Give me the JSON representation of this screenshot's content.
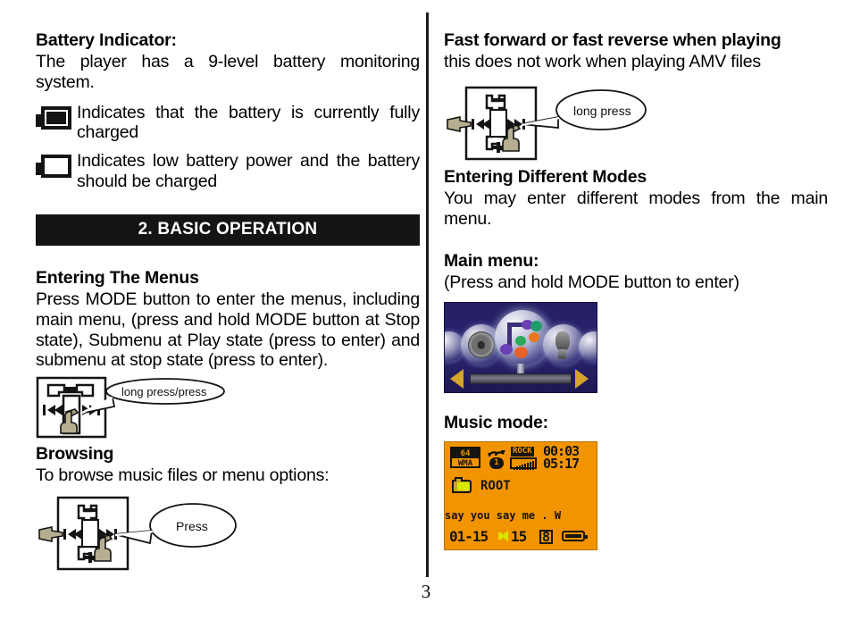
{
  "page": {
    "number": "3"
  },
  "left_column": {
    "battery_section": {
      "heading": "Battery Indicator:",
      "intro": "The player has a 9-level battery monitoring system.",
      "items": [
        {
          "icon": "battery-full-icon",
          "text": "Indicates that the battery is currently fully charged"
        },
        {
          "icon": "battery-empty-icon",
          "text": "Indicates low battery power and the battery should be charged"
        }
      ]
    },
    "section_banner": "2. BASIC OPERATION",
    "menus_section": {
      "heading": "Entering The Menus",
      "body": "Press MODE button to enter the menus, including main menu, (press and hold MODE button at Stop state), Submenu at Play state (press to enter) and submenu at stop state (press to enter).",
      "diagram": {
        "name": "mode-button-diagram",
        "callout": "long press/press"
      }
    },
    "browsing_section": {
      "heading": "Browsing",
      "body": "To browse music files or menu options:",
      "diagram": {
        "name": "browse-button-diagram",
        "callout": "Press"
      }
    }
  },
  "right_column": {
    "ff_rew_section": {
      "heading": "Fast forward or fast reverse when playing",
      "body": "this does not work when playing AMV files",
      "diagram": {
        "name": "fast-forward-button-diagram",
        "callout": "long press"
      }
    },
    "modes_section": {
      "heading": "Entering Different Modes",
      "body": "You may enter different modes from the main menu."
    },
    "main_menu_section": {
      "heading": "Main menu:",
      "body": "(Press and hold MODE button to enter)",
      "screen": {
        "name": "main-menu-lcd",
        "background_color": "#241f63",
        "arrow_color": "#d6a42c",
        "icons": [
          "gear-icon",
          "music-note-icon",
          "microphone-icon",
          "recorder-icon"
        ]
      }
    },
    "music_mode_section": {
      "heading": "Music mode:",
      "screen": {
        "name": "music-mode-lcd",
        "background_color": "#f29400",
        "bitrate": "64",
        "format": "WMA",
        "repeat_count": "1",
        "eq_label": "ROCK",
        "elapsed_time": "00:03",
        "total_time": "05:17",
        "folder": "ROOT",
        "track_title": "say you say me . W",
        "track_index": "01-15",
        "volume": "15",
        "eq_icon": "8",
        "battery_icon": "battery-full-icon"
      }
    }
  }
}
